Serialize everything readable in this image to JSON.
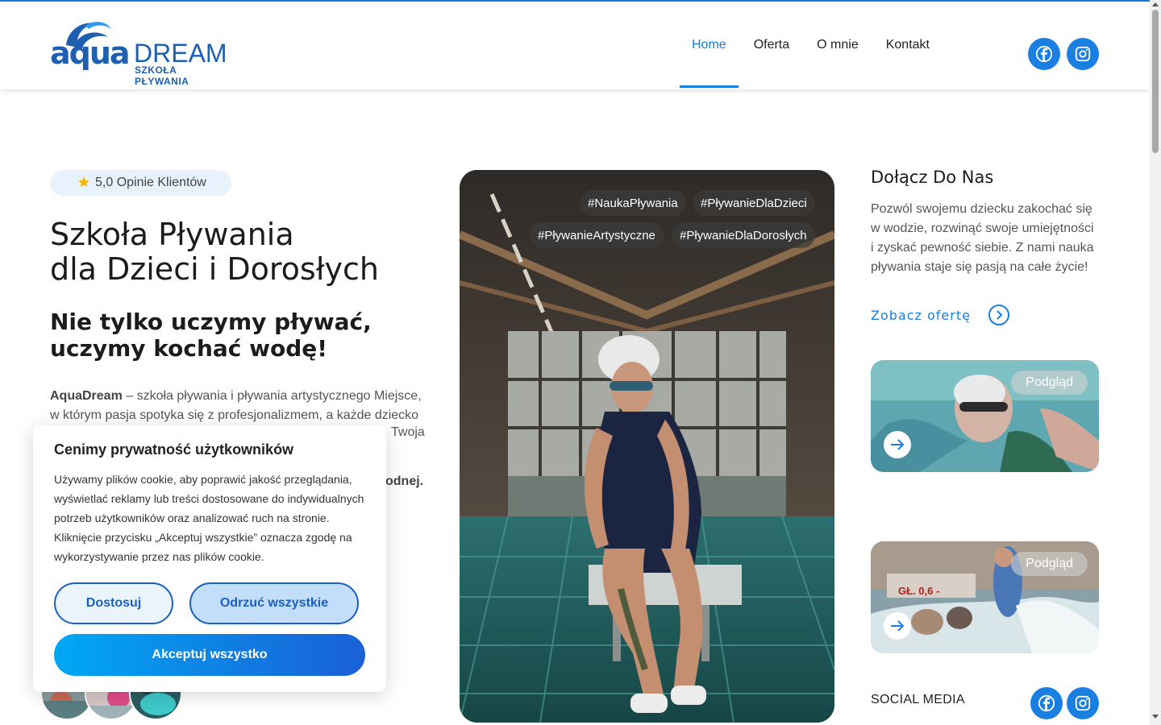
{
  "brand": {
    "logo_main": "aqua",
    "logo_dream": "DREAM",
    "logo_sub": "SZKOŁA PŁYWANIA",
    "accent": "#1a7fe0",
    "logo_color": "#1e5fb0"
  },
  "nav": {
    "items": [
      {
        "label": "Home",
        "active": true
      },
      {
        "label": "Oferta",
        "active": false
      },
      {
        "label": "O mnie",
        "active": false
      },
      {
        "label": "Kontakt",
        "active": false
      }
    ],
    "social": [
      "facebook-icon",
      "instagram-icon"
    ]
  },
  "hero": {
    "rating": "5,0 Opinie Klientów",
    "title_line1": "Szkoła Pływania",
    "title_line2": "dla Dzieci i Dorosłych",
    "subtitle_line1": "Nie tylko uczymy pływać,",
    "subtitle_line2": "uczymy kochać wodę!",
    "para_brand": "AquaDream",
    "para_text": " – szkoła pływania i pływania artystycznego Miejsce, w którym pasja spotyka się z profesjonalizmem, a każde dziecko",
    "para_visible_tail": "Twoja",
    "para_end": "odnej.",
    "tags": [
      "#NaukaPływania",
      "#PływanieDlaDzieci",
      "#PływanieArtystyczne",
      "#PływanieDlaDorosłych"
    ]
  },
  "cookie": {
    "title": "Cenimy prywatność użytkowników",
    "text": "Używamy plików cookie, aby poprawić jakość przeglądania, wyświetlać reklamy lub treści dostosowane do indywidualnych potrzeb użytkowników oraz analizować ruch na stronie. Kliknięcie przycisku „Akceptuj wszystkie” oznacza zgodę na wykorzystywanie przez nas plików cookie.",
    "customize": "Dostosuj",
    "reject": "Odrzuć wszystkie",
    "accept": "Akceptuj wszystko"
  },
  "sidebar": {
    "title": "Dołącz Do Nas",
    "text": "Pozwól swojemu dziecku zakochać się w wodzie, rozwinąć swoje umiejętności i zyskać pewność siebie. Z nami nauka pływania staje się pasją na całe życie!",
    "offer_link": "Zobacz ofertę",
    "previews": [
      {
        "badge": "Podgląd"
      },
      {
        "badge": "Podgląd",
        "sign": "GŁ. 0,6 -"
      }
    ],
    "social_label": "SOCIAL MEDIA"
  }
}
